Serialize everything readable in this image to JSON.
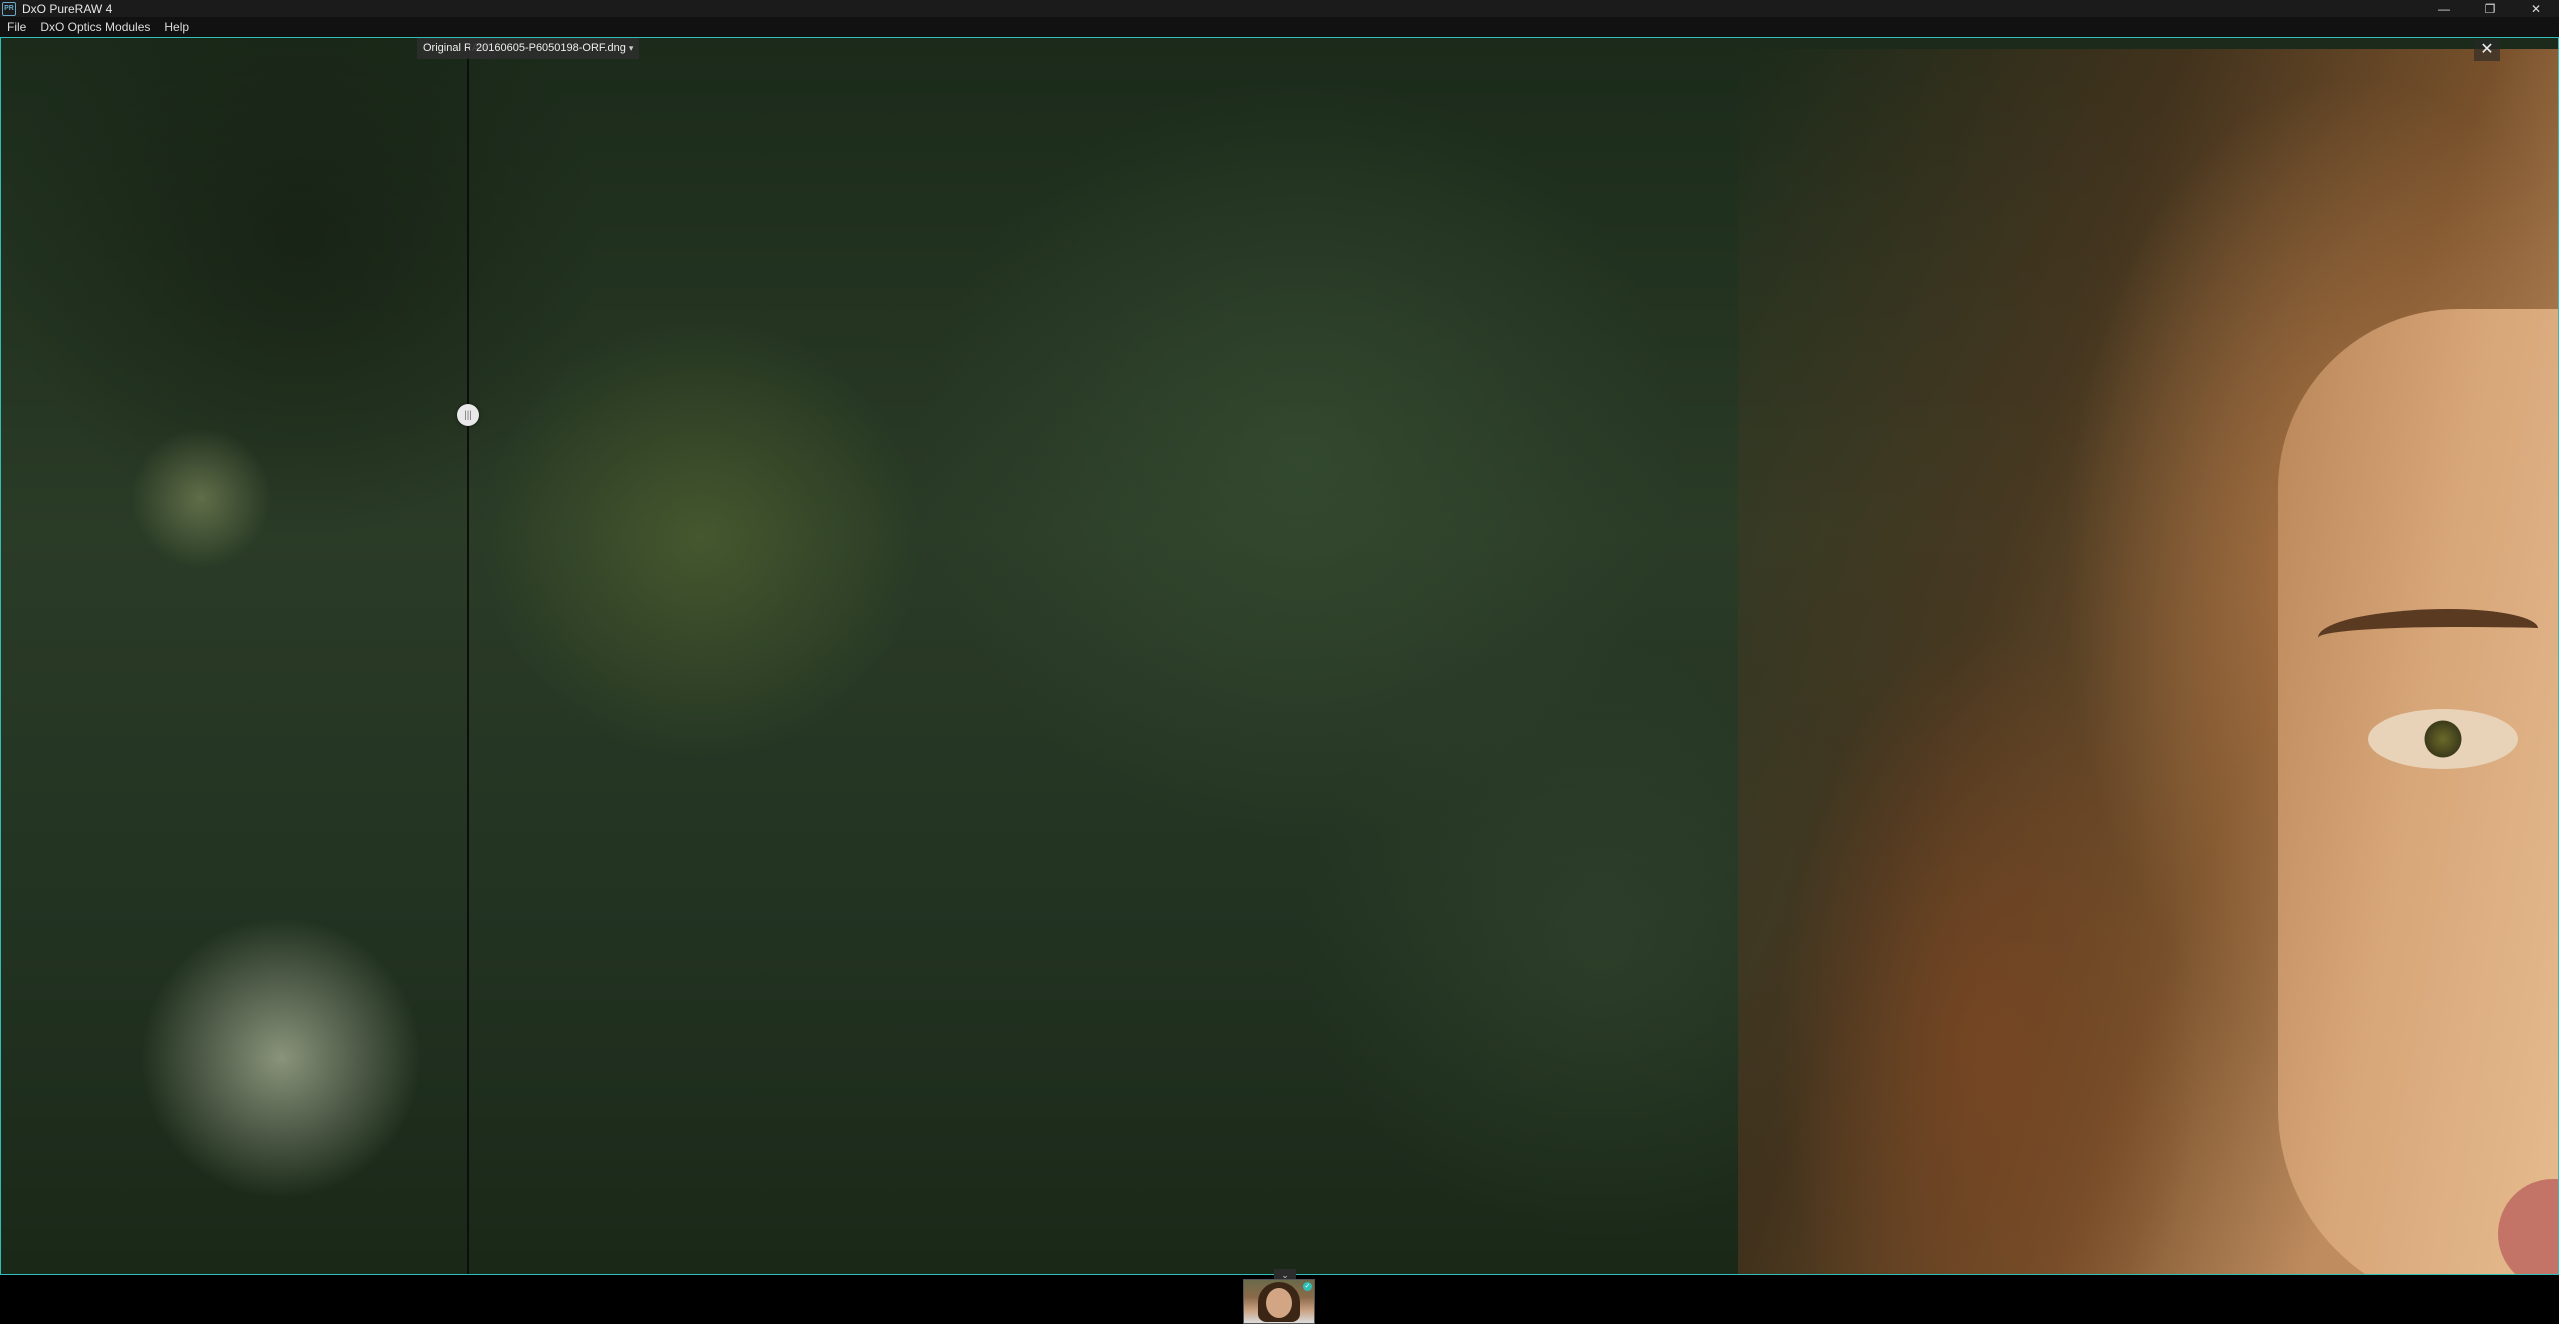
{
  "window": {
    "title": "DxO PureRAW 4",
    "app_icon": "PR",
    "minimize": "—",
    "maximize": "❐",
    "close": "✕"
  },
  "menu": {
    "items": [
      "File",
      "DxO Optics Modules",
      "Help"
    ]
  },
  "viewer": {
    "original_label": "Original RAW",
    "file_name": "20160605-P6050198-ORF.dng",
    "close_label": "✕",
    "split_handle_label": "|||"
  },
  "filmstrip": {
    "toggle_label": "⌄",
    "thumbnail_check": "✓"
  },
  "colors": {
    "accent": "#2fbfb7",
    "titlebar": "#1b1b1b",
    "menubar": "#111111"
  }
}
